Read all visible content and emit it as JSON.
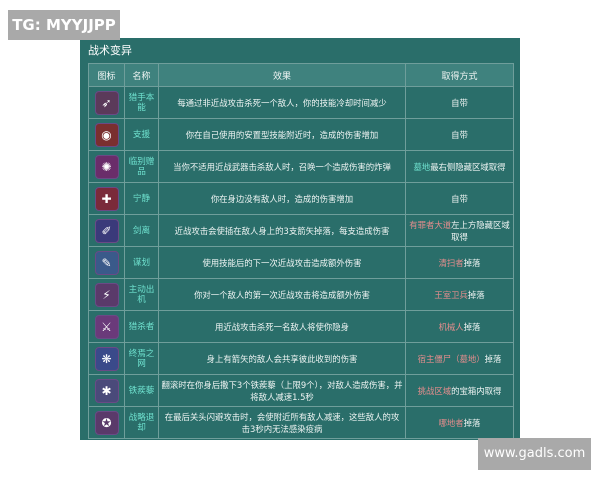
{
  "watermarks": {
    "top": "TG: MYYJJPP",
    "bottom": "www.gadls.com"
  },
  "panel": {
    "title": "战术变异",
    "headers": {
      "icon": "图标",
      "name": "名称",
      "effect": "效果",
      "source": "取得方式"
    },
    "rows": [
      {
        "icon": "bow-arrow-icon",
        "glyph": "➶",
        "bg": "#5b3a5a",
        "name": "猎手本能",
        "effect": "每通过非近战攻击杀死一个敌人，你的技能冷却时间减少",
        "src": [
          {
            "t": "自带",
            "c": ""
          }
        ]
      },
      {
        "icon": "target-icon",
        "glyph": "◉",
        "bg": "#7a2f2f",
        "name": "支援",
        "effect": "你在自己使用的安置型技能附近时，造成的伤害增加",
        "src": [
          {
            "t": "自带",
            "c": ""
          }
        ]
      },
      {
        "icon": "totem-icon",
        "glyph": "✺",
        "bg": "#6a2d6a",
        "name": "临别赠品",
        "effect": "当你不适用近战武器击杀敌人时，召唤一个造成伤害的炸弹",
        "src": [
          {
            "t": "墓地",
            "c": "gn"
          },
          {
            "t": "最右侧隐藏区域取得",
            "c": ""
          }
        ]
      },
      {
        "icon": "cross-icon",
        "glyph": "✚",
        "bg": "#7a2a3a",
        "name": "宁静",
        "effect": "你在身边没有敌人时，造成的伤害增加",
        "src": [
          {
            "t": "自带",
            "c": ""
          }
        ]
      },
      {
        "icon": "spikes-icon",
        "glyph": "✐",
        "bg": "#3a3a7a",
        "name": "剑离",
        "effect": "近战攻击会使插在敌人身上的3支箭矢掉落，每支造成伤害",
        "src": [
          {
            "t": "有罪者大道",
            "c": "hl"
          },
          {
            "t": "左上方隐藏区域取得",
            "c": ""
          }
        ]
      },
      {
        "icon": "scroll-icon",
        "glyph": "✎",
        "bg": "#3a5a8a",
        "name": "谋划",
        "effect": "使用技能后的下一次近战攻击造成额外伤害",
        "src": [
          {
            "t": "清扫者",
            "c": "hl"
          },
          {
            "t": "掉落",
            "c": ""
          }
        ]
      },
      {
        "icon": "lightning-icon",
        "glyph": "⚡",
        "bg": "#5a3a6a",
        "name": "主动出机",
        "effect": "你对一个敌人的第一次近战攻击将造成额外伤害",
        "src": [
          {
            "t": "王室卫兵",
            "c": "hl"
          },
          {
            "t": "掉落",
            "c": ""
          }
        ]
      },
      {
        "icon": "dagger-icon",
        "glyph": "⚔",
        "bg": "#6a3a7a",
        "name": "猎杀者",
        "effect": "用近战攻击杀死一名敌人将使你隐身",
        "src": [
          {
            "t": "机械人",
            "c": "hl"
          },
          {
            "t": "掉落",
            "c": ""
          }
        ]
      },
      {
        "icon": "web-icon",
        "glyph": "❋",
        "bg": "#3a4a8a",
        "name": "终焉之网",
        "effect": "身上有箭矢的敌人会共享彼此收到的伤害",
        "src": [
          {
            "t": "宿主僵尸（墓地）",
            "c": "hl"
          },
          {
            "t": "掉落",
            "c": ""
          }
        ]
      },
      {
        "icon": "caltrops-icon",
        "glyph": "✱",
        "bg": "#4a4a7a",
        "name": "铁蒺藜",
        "effect": "翻滚时在你身后撒下3个铁蒺藜（上限9个），对敌人造成伤害，并将敌人减速1.5秒",
        "src": [
          {
            "t": "挑战区域",
            "c": "hl"
          },
          {
            "t": "的宝箱内取得",
            "c": ""
          }
        ]
      },
      {
        "icon": "clock-icon",
        "glyph": "✪",
        "bg": "#5a3a6a",
        "name": "战略退却",
        "effect": "在最后关头闪避攻击时，会使附近所有敌人减速，这些敌人的攻击3秒内无法感染疫病",
        "src": [
          {
            "t": "哪地者",
            "c": "hl"
          },
          {
            "t": "掉落",
            "c": ""
          }
        ]
      }
    ]
  }
}
